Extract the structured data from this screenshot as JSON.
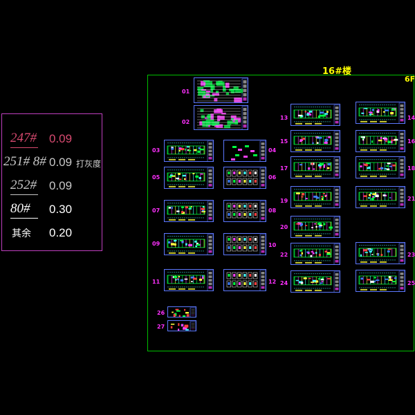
{
  "legend": {
    "rows": [
      {
        "name": "247#",
        "value": "0.09",
        "name_color": "#d84a70",
        "value_color": "#d84a70",
        "underline": true,
        "note": ""
      },
      {
        "name": "251# 8#",
        "value": "0.09",
        "name_color": "#c8c8c8",
        "value_color": "#c8c8c8",
        "underline": false,
        "note": "打灰度"
      },
      {
        "name": "252#",
        "value": "0.09",
        "name_color": "#c8c8c8",
        "value_color": "#c8c8c8",
        "underline": true,
        "note": ""
      },
      {
        "name": "80#",
        "value": "0.30",
        "name_color": "#ffffff",
        "value_color": "#ffffff",
        "underline": true,
        "note": ""
      },
      {
        "name": "其余",
        "value": "0.20",
        "name_color": "#ffffff",
        "value_color": "#ffffff",
        "underline": false,
        "note": ""
      }
    ]
  },
  "layout": {
    "title": "16#楼",
    "floors": "6F"
  },
  "sheets": [
    {
      "num": "01",
      "kind": "plan-dense"
    },
    {
      "num": "02",
      "kind": "plan-dense"
    },
    {
      "num": "03",
      "kind": "floor"
    },
    {
      "num": "04",
      "kind": "detail-sparse"
    },
    {
      "num": "05",
      "kind": "floor"
    },
    {
      "num": "06",
      "kind": "detail-grid"
    },
    {
      "num": "07",
      "kind": "floor"
    },
    {
      "num": "08",
      "kind": "detail-grid"
    },
    {
      "num": "09",
      "kind": "floor"
    },
    {
      "num": "10",
      "kind": "detail-grid"
    },
    {
      "num": "11",
      "kind": "floor"
    },
    {
      "num": "12",
      "kind": "detail-grid"
    },
    {
      "num": "13",
      "kind": "floor"
    },
    {
      "num": "14",
      "kind": "floor"
    },
    {
      "num": "15",
      "kind": "floor"
    },
    {
      "num": "16",
      "kind": "floor"
    },
    {
      "num": "17",
      "kind": "floor"
    },
    {
      "num": "18",
      "kind": "floor"
    },
    {
      "num": "19",
      "kind": "floor"
    },
    {
      "num": "20",
      "kind": "floor"
    },
    {
      "num": "21",
      "kind": "floor"
    },
    {
      "num": "22",
      "kind": "floor"
    },
    {
      "num": "23",
      "kind": "floor"
    },
    {
      "num": "24",
      "kind": "floor"
    },
    {
      "num": "25",
      "kind": "floor"
    },
    {
      "num": "26",
      "kind": "small"
    },
    {
      "num": "27",
      "kind": "small"
    }
  ],
  "colors": {
    "frame": "#00c000",
    "sheet_border": "#5c78ff",
    "sheet_number": "#ff30ff",
    "title": "#ffff00",
    "legend_border": "#c040c0"
  }
}
